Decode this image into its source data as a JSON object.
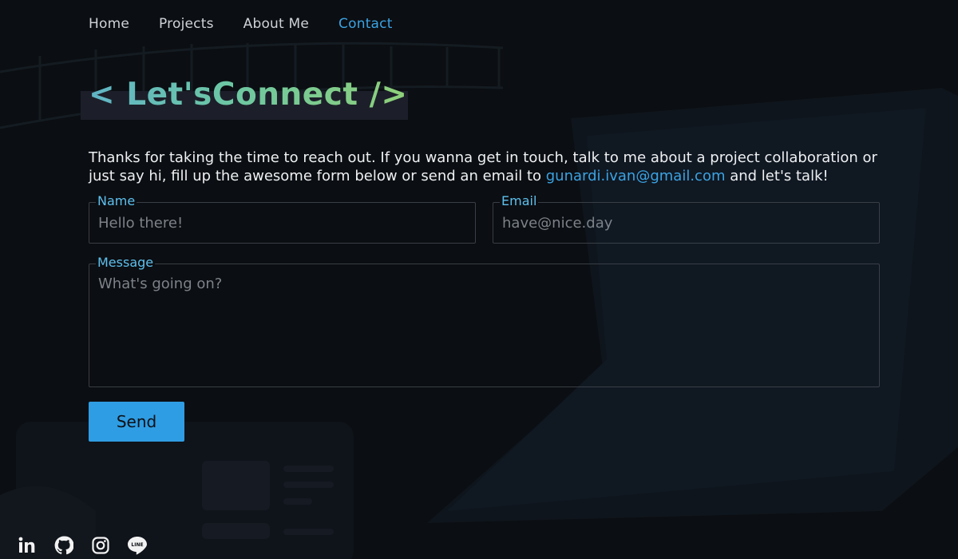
{
  "nav": {
    "items": [
      {
        "label": "Home",
        "active": false
      },
      {
        "label": "Projects",
        "active": false
      },
      {
        "label": "About Me",
        "active": false
      },
      {
        "label": "Contact",
        "active": true
      }
    ]
  },
  "heading": {
    "text": "< Let'sConnect />"
  },
  "intro": {
    "before_email": "Thanks for taking the time to reach out. If you wanna get in touch, talk to me about a project collaboration or just say hi, fill up the awesome form below or send an email to ",
    "email": "gunardi.ivan@gmail.com",
    "after_email": " and let's talk!"
  },
  "form": {
    "name": {
      "label": "Name",
      "placeholder": "Hello there!"
    },
    "email": {
      "label": "Email",
      "placeholder": "have@nice.day"
    },
    "message": {
      "label": "Message",
      "placeholder": "What's going on?"
    },
    "send_label": "Send"
  },
  "social": [
    {
      "icon": "linkedin-icon"
    },
    {
      "icon": "github-icon"
    },
    {
      "icon": "instagram-icon"
    },
    {
      "icon": "line-icon"
    }
  ],
  "colors": {
    "background": "#0b0e12",
    "accent": "#3ba3e3",
    "label": "#5ec0ee",
    "button": "#2f9de3",
    "heading_gradient_start": "#5fb3c8",
    "heading_gradient_end": "#8fd079"
  }
}
